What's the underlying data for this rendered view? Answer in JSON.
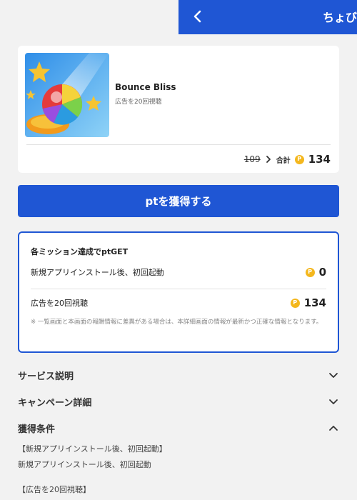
{
  "header": {
    "title": "ちょびリッチ"
  },
  "offer": {
    "app_name": "Bounce Bliss",
    "subtitle": "広告を20回視聴",
    "old_points": "109",
    "total_label": "合計",
    "coin_symbol": "P",
    "total_points": "134"
  },
  "cta": {
    "label": "ptを獲得する"
  },
  "missions": {
    "title": "各ミッション達成でptGET",
    "items": [
      {
        "label": "新規アプリインストール後、初回起動",
        "points": "0"
      },
      {
        "label": "広告を20回視聴",
        "points": "134"
      }
    ],
    "note": "※ 一覧画面と本画面の報酬情報に差異がある場合は、本詳細画面の情報が最新かつ正確な情報となります。"
  },
  "accordion": [
    {
      "label": "サービス説明",
      "state": "collapsed"
    },
    {
      "label": "キャンペーン詳細",
      "state": "collapsed"
    },
    {
      "label": "獲得条件",
      "state": "expanded"
    }
  ],
  "conditions": {
    "c1_title": "【新規アプリインストール後、初回起動】",
    "c1_text": "新規アプリインストール後、初回起動",
    "c2_title": "【広告を20回視聴】"
  },
  "colors": {
    "primary": "#1f56d4",
    "coin": "#f4b71d",
    "background": "#f2f2f2"
  }
}
